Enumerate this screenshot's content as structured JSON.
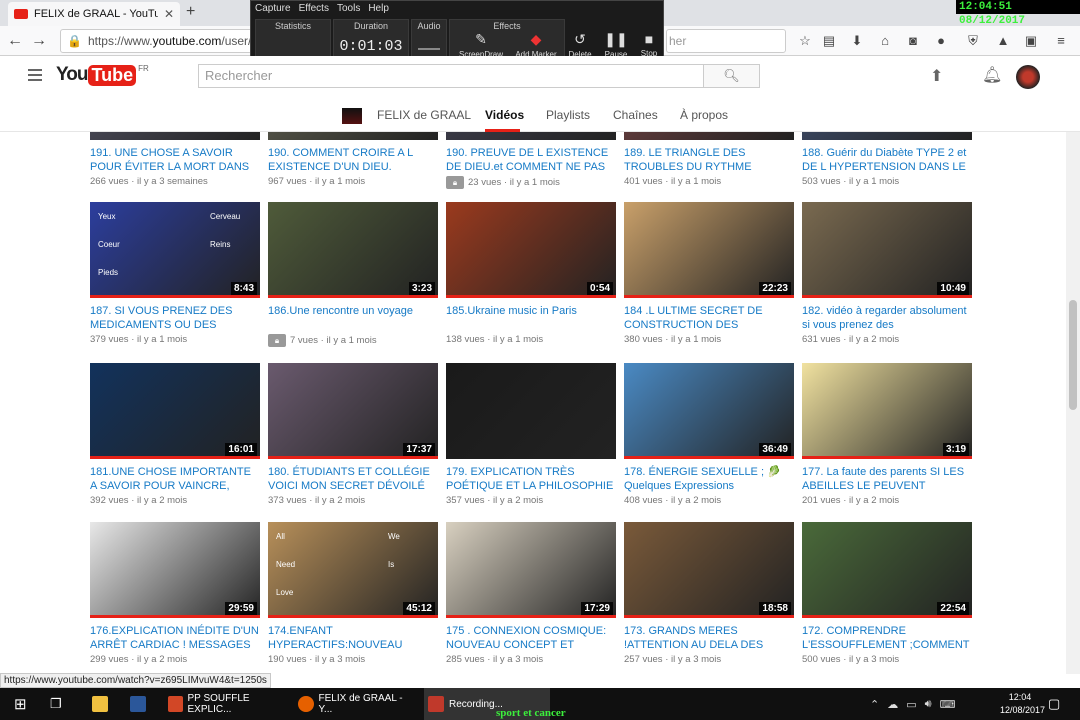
{
  "browser": {
    "tab_title": "FELIX de GRAAL - YouTube",
    "url_prefix": "https://www.",
    "url_domain": "youtube.com",
    "url_rest": "/user/a",
    "search_placeholder": "her",
    "clock": "12:04:51 08/12/2017",
    "tab_close": "✕",
    "new_tab": "+"
  },
  "recorder": {
    "menu": [
      "Capture",
      "Effects",
      "Tools",
      "Help"
    ],
    "statistics_label": "Statistics",
    "duration_label": "Duration",
    "duration": "0:01:03",
    "audio_label": "Audio",
    "effects_label": "Effects",
    "screendraw_label": "ScreenDraw",
    "marker_label": "Add Marker",
    "delete_label": "Delete",
    "pause_label": "Pause",
    "stop_label": "Stop"
  },
  "youtube": {
    "logo_you": "You",
    "logo_tube": "Tube",
    "logo_country": "FR",
    "search_placeholder": "Rechercher",
    "channel_name": "FELIX de GRAAL",
    "tabs": [
      "Vidéos",
      "Playlists",
      "Chaînes",
      "À propos"
    ]
  },
  "videos": [
    {
      "title": "191. UNE CHOSE A SAVOIR POUR ÉVITER LA MORT DANS LE",
      "views": "266 vues",
      "age": "il y a 3 semaines",
      "duration": "",
      "color": "#556",
      "locked": false
    },
    {
      "title": "190. COMMENT CROIRE A L EXISTENCE D'UN DIEU.",
      "views": "967 vues",
      "age": "il y a 1 mois",
      "duration": "",
      "color": "#665",
      "locked": false
    },
    {
      "title": "190. PREUVE DE L EXISTENCE DE DIEU.et COMMENT NE PAS",
      "views": "23 vues",
      "age": "il y a 1 mois",
      "duration": "",
      "color": "#445",
      "locked": true
    },
    {
      "title": "189. LE TRIANGLE DES TROUBLES DU RYTHME",
      "views": "401 vues",
      "age": "il y a 1 mois",
      "duration": "",
      "color": "#744",
      "locked": false
    },
    {
      "title": "188. Guérir du Diabète TYPE 2 et DE L HYPERTENSION DANS LE",
      "views": "503 vues",
      "age": "il y a 1 mois",
      "duration": "",
      "color": "#457",
      "locked": false
    },
    {
      "title": "187. SI VOUS PRENEZ DES MEDICAMENTS OU DES",
      "views": "379 vues",
      "age": "il y a 1 mois",
      "duration": "8:43",
      "color": "#2c3e9e",
      "locked": false,
      "labels": [
        "Yeux",
        "Cerveau",
        "Coeur",
        "Reins",
        "Pieds"
      ]
    },
    {
      "title": "186.Une rencontre un voyage",
      "views": "7 vues",
      "age": "il y a 1 mois",
      "duration": "3:23",
      "color": "#4f5b3a",
      "locked": true
    },
    {
      "title": "185.Ukraine music in Paris",
      "views": "138 vues",
      "age": "il y a 1 mois",
      "duration": "0:54",
      "color": "#9b3a1e",
      "locked": false
    },
    {
      "title": "184 .L ULTIME SECRET DE CONSTRUCTION DES",
      "views": "380 vues",
      "age": "il y a 1 mois",
      "duration": "22:23",
      "color": "#c9a06a",
      "locked": false
    },
    {
      "title": "182. vidéo à regarder absolument si vous prenez des",
      "views": "631 vues",
      "age": "il y a 2 mois",
      "duration": "10:49",
      "color": "#7a6a50",
      "locked": false
    },
    {
      "title": "181.UNE CHOSE IMPORTANTE A SAVOIR POUR VAINCRE, Cancer,...",
      "views": "392 vues",
      "age": "il y a 2 mois",
      "duration": "16:01",
      "color": "#12325c",
      "locked": false
    },
    {
      "title": "180. ÉTUDIANTS ET COLLÉGIE VOICI MON SECRET DÉVOILÉ",
      "views": "373 vues",
      "age": "il y a 2 mois",
      "duration": "17:37",
      "color": "#6a5a6e",
      "locked": false
    },
    {
      "title": "179. EXPLICATION TRÈS POÉTIQUE ET LA PHILOSOPHIE ...",
      "views": "357 vues",
      "age": "il y a 2 mois",
      "duration": "",
      "color": "#1a1a1a",
      "locked": false
    },
    {
      "title": "178. ÉNERGIE SEXUELLE ; 🥬 Quelques Expressions",
      "views": "408 vues",
      "age": "il y a 2 mois",
      "duration": "36:49",
      "color": "#4a8ac4",
      "locked": false
    },
    {
      "title": "177. La faute des parents SI LES ABEILLES LE PEUVENT",
      "views": "201 vues",
      "age": "il y a 2 mois",
      "duration": "3:19",
      "color": "#f1e2a0",
      "locked": false
    },
    {
      "title": "176.EXPLICATION INÉDITE D'UN ARRÊT CARDIAC ! MESSAGES A...",
      "views": "299 vues",
      "age": "il y a 2 mois",
      "duration": "29:59",
      "color": "#e8e8e8",
      "locked": false
    },
    {
      "title": "174.ENFANT HYPERACTIFS:NOUVEAU",
      "views": "190 vues",
      "age": "il y a 3 mois",
      "duration": "45:12",
      "color": "#b8905a",
      "locked": false,
      "labels": [
        "All",
        "We",
        "Need",
        "Is",
        "Love"
      ]
    },
    {
      "title": "175 . CONNEXION COSMIQUE: NOUVEAU CONCEPT ET ULTIME...",
      "views": "285 vues",
      "age": "il y a 3 mois",
      "duration": "17:29",
      "color": "#d8d0c0",
      "locked": false
    },
    {
      "title": "173. GRANDS MERES !ATTENTION AU DELA DES",
      "views": "257 vues",
      "age": "il y a 3 mois",
      "duration": "18:58",
      "color": "#7a5a3a",
      "locked": false
    },
    {
      "title": "172. COMPRENDRE L'ESSOUFFLEMENT ;COMMENT ...",
      "views": "500 vues",
      "age": "il y a 3 mois",
      "duration": "22:54",
      "color": "#4a6a3a",
      "locked": false
    }
  ],
  "status_url": "https://www.youtube.com/watch?v=z695LIMvuW4&t=1250s",
  "taskbar": {
    "items": [
      {
        "label": "PP SOUFFLE EXPLIC...",
        "color": "#d24726"
      },
      {
        "label": "FELIX de GRAAL - Y...",
        "color": "#e66000"
      },
      {
        "label": "Recording...",
        "color": "#c0392b"
      }
    ],
    "time": "12:04",
    "date": "12/08/2017",
    "overlay_caption": "sport et cancer"
  }
}
